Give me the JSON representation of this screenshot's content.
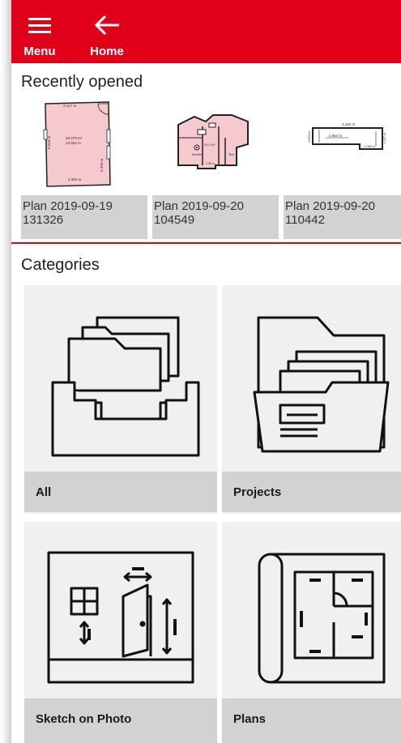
{
  "topbar": {
    "menu_label": "Menu",
    "home_label": "Home",
    "color": "#e1001a"
  },
  "recent": {
    "title": "Recently opened",
    "items": [
      {
        "line1": "Plan 2019-09-19",
        "line2": "131326",
        "thumb": {
          "top": "3.417 m",
          "area": "29.379 m²",
          "perim": "22.932 m",
          "left": "6.029 m",
          "right": "5.365 m",
          "bottom": "4.484 m"
        }
      },
      {
        "line1": "Plan 2019-09-20",
        "line2": "104549",
        "thumb": {
          "room1": "Marker",
          "room2": "Text",
          "area": "33.4 m²",
          "dim": "1.38 m"
        }
      },
      {
        "line1": "Plan 2019-09-20",
        "line2": "110442",
        "thumb": {
          "top": "3.183 m",
          "mid": "2.864 m",
          "right": "0.839 m",
          "left": "0.839 m",
          "small": "1.065 m",
          "right2": "1.257 m"
        }
      }
    ]
  },
  "categories": {
    "title": "Categories",
    "items": [
      {
        "label": "All",
        "icon": "folders-tray-icon"
      },
      {
        "label": "Projects",
        "icon": "open-folder-icon"
      },
      {
        "label": "Sketch on Photo",
        "icon": "room-sketch-icon"
      },
      {
        "label": "Plans",
        "icon": "floor-plan-icon"
      }
    ]
  },
  "colors": {
    "accent": "#e1001a",
    "caption_bg": "#d2d2d2",
    "tile_bg": "#f0f0f0",
    "plan_fill": "#f6c9cf"
  }
}
